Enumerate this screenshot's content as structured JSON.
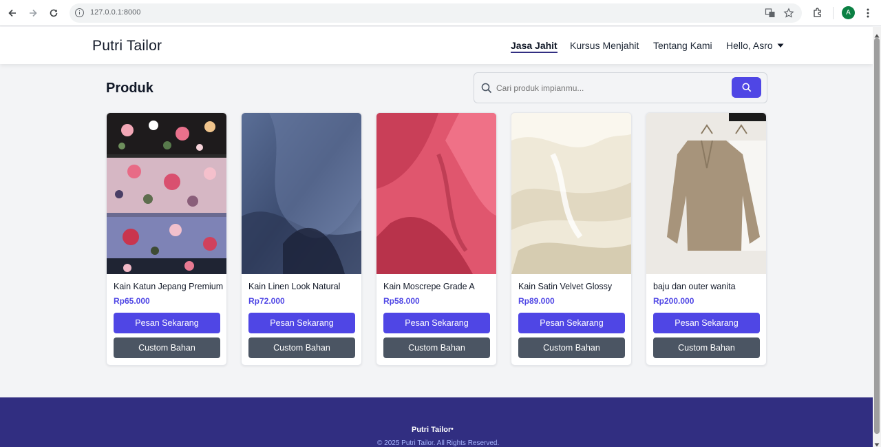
{
  "browser": {
    "url": "127.0.0.1:8000",
    "profile_initial": "A"
  },
  "header": {
    "logo": "Putri Tailor",
    "nav": [
      {
        "label": "Jasa Jahit",
        "active": true
      },
      {
        "label": "Kursus Menjahit",
        "active": false
      },
      {
        "label": "Tentang Kami",
        "active": false
      }
    ],
    "user_greeting": "Hello, Asro"
  },
  "main": {
    "title": "Produk",
    "search_placeholder": "Cari produk impianmu...",
    "products": [
      {
        "name": "Kain Katun Jepang Premium",
        "price": "Rp65.000",
        "order_label": "Pesan Sekarang",
        "custom_label": "Custom Bahan"
      },
      {
        "name": "Kain Linen Look Natural",
        "price": "Rp72.000",
        "order_label": "Pesan Sekarang",
        "custom_label": "Custom Bahan"
      },
      {
        "name": "Kain Moscrepe Grade A",
        "price": "Rp58.000",
        "order_label": "Pesan Sekarang",
        "custom_label": "Custom Bahan"
      },
      {
        "name": "Kain Satin Velvet Glossy",
        "price": "Rp89.000",
        "order_label": "Pesan Sekarang",
        "custom_label": "Custom Bahan"
      },
      {
        "name": "baju dan outer wanita",
        "price": "Rp200.000",
        "order_label": "Pesan Sekarang",
        "custom_label": "Custom Bahan"
      }
    ]
  },
  "footer": {
    "brand": "Putri Tailor",
    "separator": "•",
    "copyright": "© 2025 Putri Tailor. All Rights Reserved."
  },
  "colors": {
    "primary": "#4f46e5",
    "secondary_button": "#4b5563",
    "footer_bg": "#312e81"
  }
}
